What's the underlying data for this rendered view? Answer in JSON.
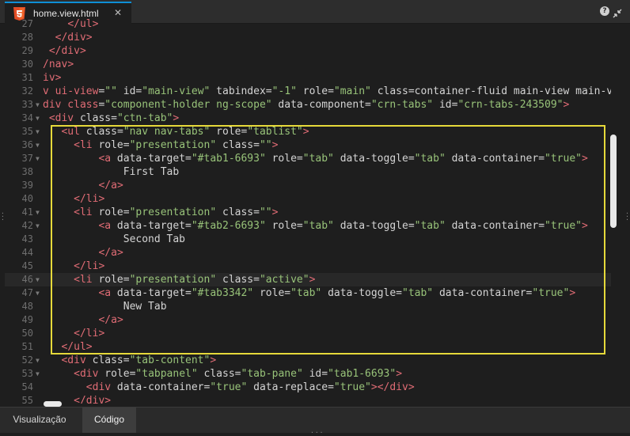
{
  "tab": {
    "title": "home.view.html",
    "icon": "html5-icon"
  },
  "toolbar": {
    "help": "?",
    "collapse": "collapse-icon"
  },
  "editor": {
    "current_line": 46,
    "lines": [
      {
        "n": "27",
        "fold": false,
        "code": "    </ul>"
      },
      {
        "n": "28",
        "fold": false,
        "code": "  </div>"
      },
      {
        "n": "29",
        "fold": false,
        "code": " </div>"
      },
      {
        "n": "30",
        "fold": false,
        "code": "/nav>"
      },
      {
        "n": "31",
        "fold": false,
        "code": "iv>"
      },
      {
        "n": "32",
        "fold": false,
        "code": "v ui-view=\"\" id=\"main-view\" tabindex=\"-1\" role=\"main\" class=\"container-fluid main-view main-v"
      },
      {
        "n": "33",
        "fold": true,
        "code": "div class=\"component-holder ng-scope\" data-component=\"crn-tabs\" id=\"crn-tabs-243509\">"
      },
      {
        "n": "34",
        "fold": true,
        "code": " <div class=\"ctn-tab\">"
      },
      {
        "n": "35",
        "fold": true,
        "code": "   <ul class=\"nav nav-tabs\" role=\"tablist\">"
      },
      {
        "n": "36",
        "fold": true,
        "code": "     <li role=\"presentation\" class=\"\">"
      },
      {
        "n": "37",
        "fold": true,
        "code": "         <a data-target=\"#tab1-6693\" role=\"tab\" data-toggle=\"tab\" data-container=\"true\">"
      },
      {
        "n": "38",
        "fold": false,
        "code": "             First Tab"
      },
      {
        "n": "39",
        "fold": false,
        "code": "         </a>"
      },
      {
        "n": "40",
        "fold": false,
        "code": "     </li>"
      },
      {
        "n": "41",
        "fold": true,
        "code": "     <li role=\"presentation\" class=\"\">"
      },
      {
        "n": "42",
        "fold": true,
        "code": "         <a data-target=\"#tab2-6693\" role=\"tab\" data-toggle=\"tab\" data-container=\"true\">"
      },
      {
        "n": "43",
        "fold": false,
        "code": "             Second Tab"
      },
      {
        "n": "44",
        "fold": false,
        "code": "         </a>"
      },
      {
        "n": "45",
        "fold": false,
        "code": "     </li>"
      },
      {
        "n": "46",
        "fold": true,
        "code": "     <li role=\"presentation\" class=\"active\">"
      },
      {
        "n": "47",
        "fold": true,
        "code": "         <a data-target=\"#tab3342\" role=\"tab\" data-toggle=\"tab\" data-container=\"true\">"
      },
      {
        "n": "48",
        "fold": false,
        "code": "             New Tab"
      },
      {
        "n": "49",
        "fold": false,
        "code": "         </a>"
      },
      {
        "n": "50",
        "fold": false,
        "code": "     </li>"
      },
      {
        "n": "51",
        "fold": false,
        "code": "   </ul>"
      },
      {
        "n": "52",
        "fold": true,
        "code": "   <div class=\"tab-content\">"
      },
      {
        "n": "53",
        "fold": true,
        "code": "     <div role=\"tabpanel\" class=\"tab-pane\" id=\"tab1-6693\">"
      },
      {
        "n": "54",
        "fold": false,
        "code": "       <div data-container=\"true\" data-replace=\"true\"></div>"
      },
      {
        "n": "55",
        "fold": false,
        "code": "     </div>"
      }
    ]
  },
  "bottom_tabs": {
    "visualizacao": "Visualização",
    "codigo": "Código"
  },
  "colors": {
    "tag": "#e06c75",
    "string": "#98c379",
    "highlight_box": "#e6d93a",
    "accent": "#0e8fd6"
  }
}
